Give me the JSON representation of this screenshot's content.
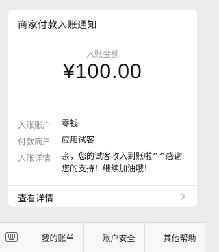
{
  "card": {
    "title": "商家付款入账通知",
    "amount_label": "入账金额",
    "amount": "¥100.00",
    "rows": [
      {
        "label": "入账账户",
        "value": "零钱"
      },
      {
        "label": "付款商户",
        "value": "应用试客"
      },
      {
        "label": "入账详情",
        "value": "亲，您的试客收入到账啦^^感谢您的支持！继续加油哦！"
      }
    ],
    "detail_link": "查看详情"
  },
  "menu": {
    "items": [
      {
        "label": "我的账单"
      },
      {
        "label": "账户安全"
      },
      {
        "label": "其他帮助"
      }
    ]
  }
}
